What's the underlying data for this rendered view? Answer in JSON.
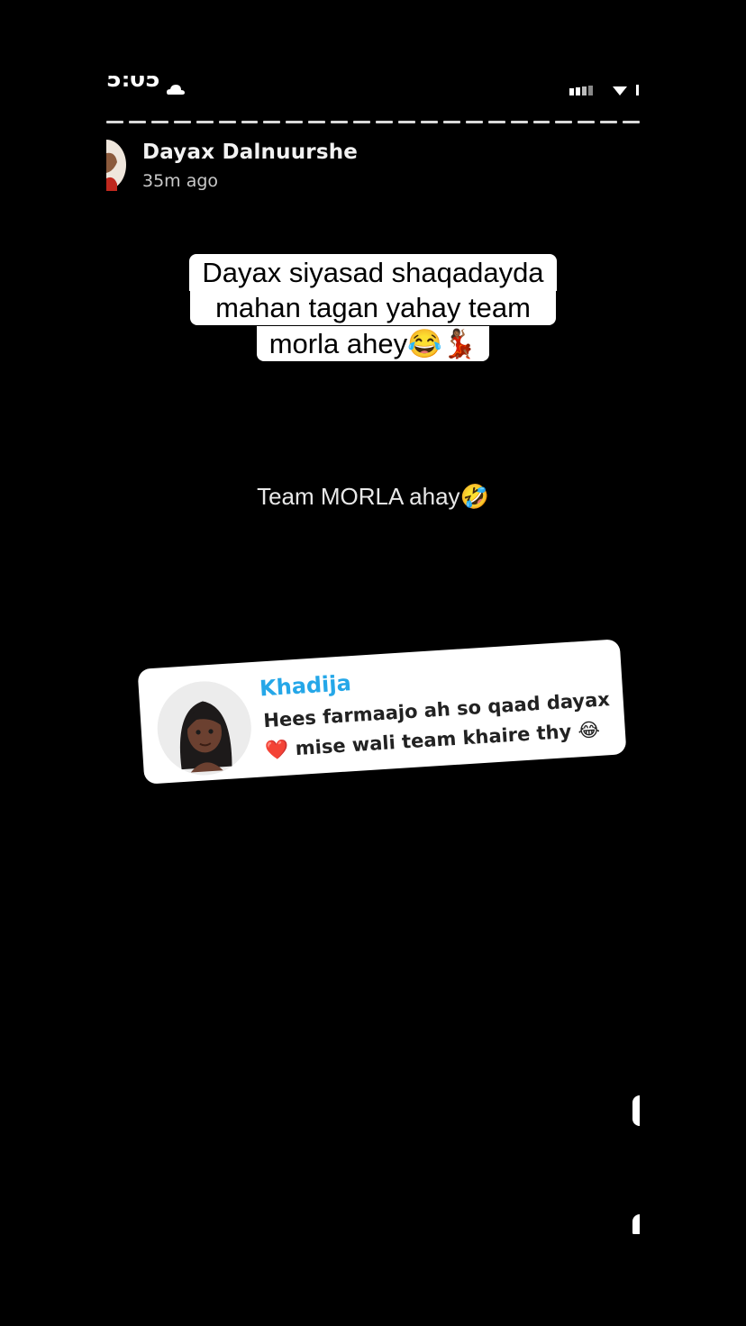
{
  "status_bar": {
    "time": "5:05"
  },
  "story": {
    "poster_name": "Dayax Dalnuurshe",
    "posted_ago": "35m ago",
    "progress_segments": 24
  },
  "caption": {
    "line1": "Dayax siyasad shaqadayda",
    "line2": "mahan tagan yahay team",
    "line3": "morla ahey😂💃🏾"
  },
  "story_text": "Team MORLA ahay🤣",
  "reply": {
    "name": "Khadija",
    "message": "Hees farmaajo ah so qaad dayax ❤️ mise wali team khaire thy 😂"
  },
  "colors": {
    "background": "#000000",
    "reply_name": "#25a7e8",
    "caption_bg": "#ffffff"
  },
  "icons": [
    "status-cloud-icon",
    "signal-icon",
    "wifi-icon",
    "battery-icon"
  ]
}
